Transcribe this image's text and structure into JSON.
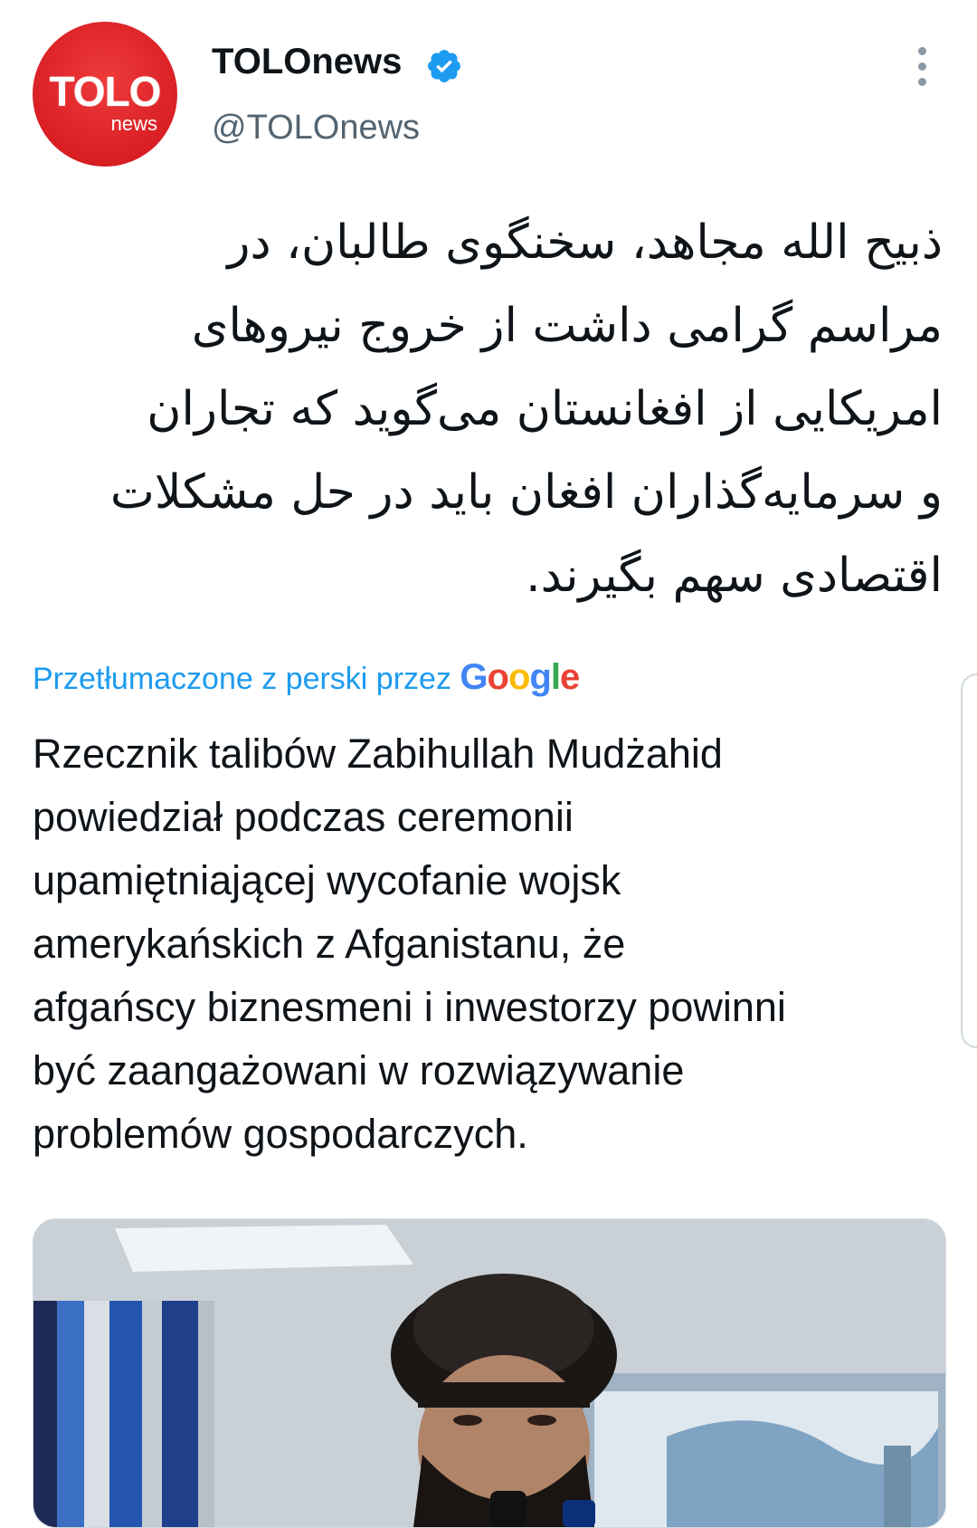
{
  "author": {
    "display_name": "TOLOnews",
    "handle": "@TOLOnews",
    "verified": true,
    "avatar": {
      "logo_main": "TOLO",
      "logo_sub": "news",
      "color": "#d91f24"
    }
  },
  "tweet": {
    "original_lines": [
      "ذبیح الله مجاهد، سخنگوی طالبان، در",
      "مراسم گرامی داشت از خروج نیروهای",
      "امریکایی از افغانستان می‌گوید که تجاران",
      "و سرمایه‌گذاران افغان باید در حل مشکلات",
      "اقتصادی سهم بگیرند."
    ],
    "translated_by_label": "Przetłumaczone z perski przez",
    "translation_provider": "Google",
    "translation_lines": [
      "Rzecznik talibów Zabihullah Mudżahid",
      "powiedział podczas ceremonii",
      "upamiętniającej wycofanie wojsk",
      "amerykańskich z Afganistanu, że",
      "afgańscy biznesmeni i inwestorzy powinni",
      "być zaangażowani w rozwiązywanie",
      "problemów gospodarczych."
    ]
  },
  "icons": {
    "verified": "verified-badge-icon",
    "more": "more-options-icon"
  },
  "colors": {
    "link": "#1d9bf0",
    "secondary_text": "#536471",
    "primary_text": "#0f1419",
    "verified": "#1d9bf0"
  }
}
